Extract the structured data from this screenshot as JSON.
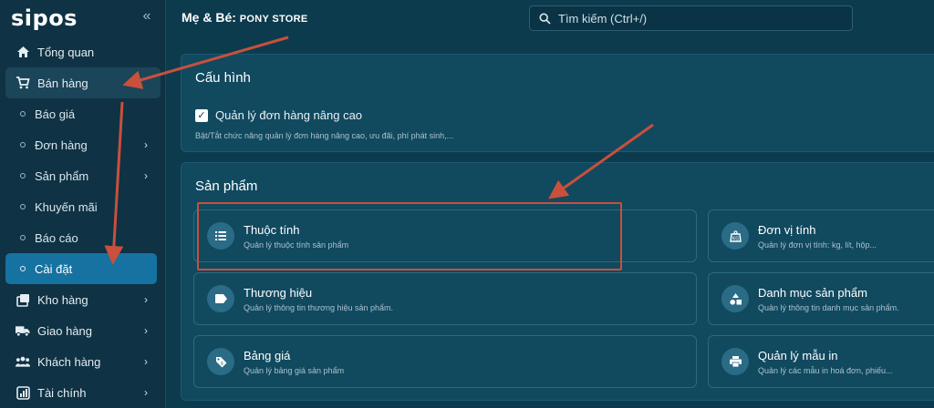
{
  "app": {
    "logo": "sipos"
  },
  "sidebar": {
    "items": [
      {
        "label": "Tổng quan",
        "icon": "home-icon"
      },
      {
        "label": "Bán hàng",
        "icon": "cart-icon"
      },
      {
        "label": "Báo giá"
      },
      {
        "label": "Đơn hàng"
      },
      {
        "label": "Sản phẩm"
      },
      {
        "label": "Khuyến mãi"
      },
      {
        "label": "Báo cáo"
      },
      {
        "label": "Cài đặt"
      },
      {
        "label": "Kho hàng",
        "icon": "warehouse-icon"
      },
      {
        "label": "Giao hàng",
        "icon": "truck-icon"
      },
      {
        "label": "Khách hàng",
        "icon": "users-icon"
      },
      {
        "label": "Tài chính",
        "icon": "finance-icon"
      }
    ]
  },
  "header": {
    "title_prefix": "Mẹ & Bé: ",
    "store_name": "PONY STORE",
    "search_placeholder": "Tìm kiếm (Ctrl+/)"
  },
  "config": {
    "title": "Cấu hình",
    "checkbox_label": "Quản lý đơn hàng nâng cao",
    "checked": true,
    "hint": "Bật/Tắt chức năng quản lý đơn hàng nâng cao, ưu đãi, phí phát sinh,..."
  },
  "products": {
    "title": "Sản phẩm",
    "tiles": [
      {
        "title": "Thuộc tính",
        "desc": "Quản lý thuộc tính sản phẩm",
        "icon": "list-icon"
      },
      {
        "title": "Đơn vị tính",
        "desc": "Quản lý đơn vị tính: kg, lít, hộp...",
        "icon": "scale-icon"
      },
      {
        "title": "Thương hiệu",
        "desc": "Quản lý thông tin thương hiệu sản phẩm.",
        "icon": "label-icon"
      },
      {
        "title": "Danh mục sản phẩm",
        "desc": "Quản lý thông tin danh mục sản phẩm.",
        "icon": "category-icon"
      },
      {
        "title": "Bảng giá",
        "desc": "Quản lý bảng giá sản phẩm",
        "icon": "price-tag-icon"
      },
      {
        "title": "Quản lý mẫu in",
        "desc": "Quản lý các mẫu in hoá đơn, phiếu...",
        "icon": "printer-icon"
      }
    ]
  },
  "colors": {
    "accent": "#1672a0",
    "annotation": "#c8503d",
    "background": "#0d3b4e"
  }
}
